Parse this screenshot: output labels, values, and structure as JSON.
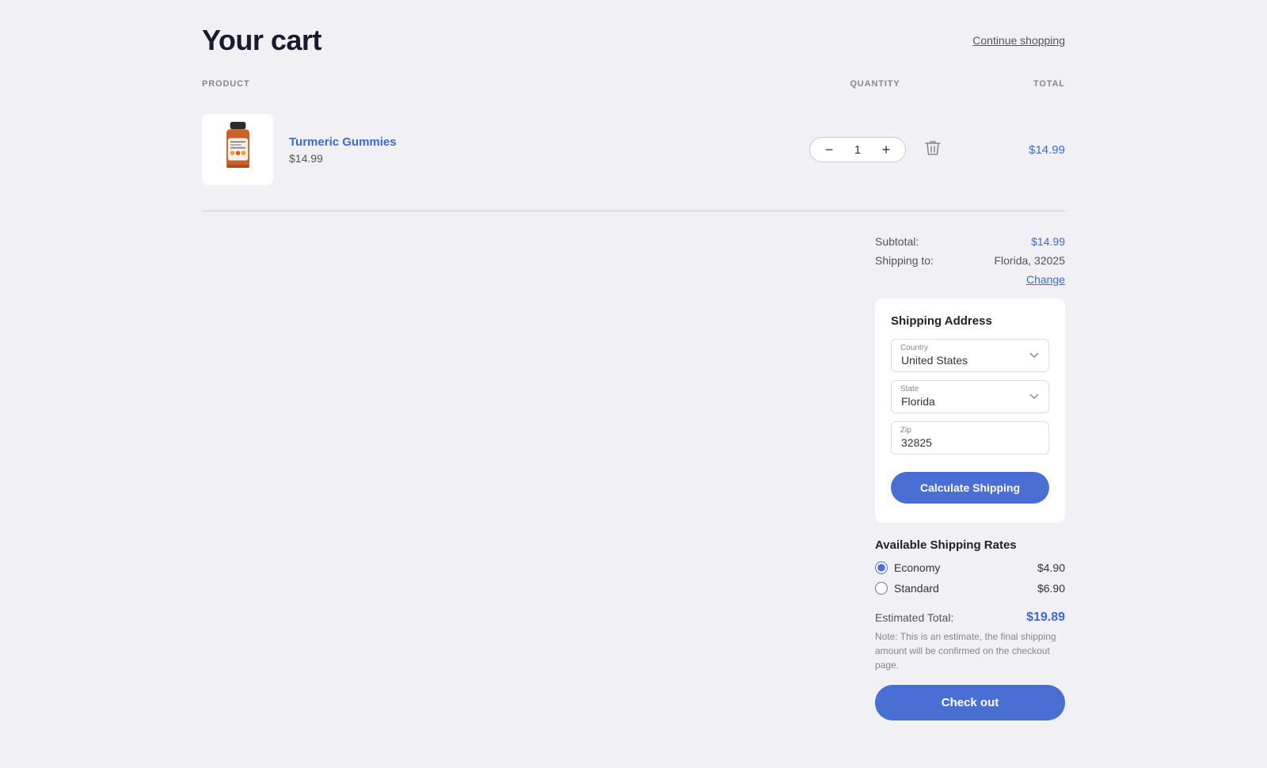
{
  "page": {
    "title": "Your cart",
    "continue_shopping_label": "Continue shopping"
  },
  "columns": {
    "product": "PRODUCT",
    "quantity": "QUANTITY",
    "total": "TOTAL"
  },
  "cart_item": {
    "name": "Turmeric Gummies",
    "price": "$14.99",
    "quantity": 1,
    "total": "$14.99"
  },
  "summary": {
    "subtotal_label": "Subtotal:",
    "subtotal_value": "$14.99",
    "shipping_to_label": "Shipping to:",
    "shipping_to_value": "Florida, 32025",
    "change_label": "Change"
  },
  "shipping_address": {
    "title": "Shipping Address",
    "country_label": "Country",
    "country_value": "United States",
    "state_label": "State",
    "state_value": "Florida",
    "zip_label": "Zip",
    "zip_value": "32825",
    "calculate_btn": "Calculate Shipping"
  },
  "shipping_rates": {
    "title": "Available Shipping Rates",
    "rates": [
      {
        "name": "Economy",
        "price": "$4.90",
        "selected": true
      },
      {
        "name": "Standard",
        "price": "$6.90",
        "selected": false
      }
    ]
  },
  "estimated_total": {
    "label": "Estimated Total:",
    "value": "$19.89",
    "note": "Note: This is an estimate, the final shipping amount will be confirmed on the checkout page.",
    "checkout_btn": "Check out"
  },
  "icons": {
    "minus": "−",
    "plus": "+",
    "trash": "🗑"
  }
}
